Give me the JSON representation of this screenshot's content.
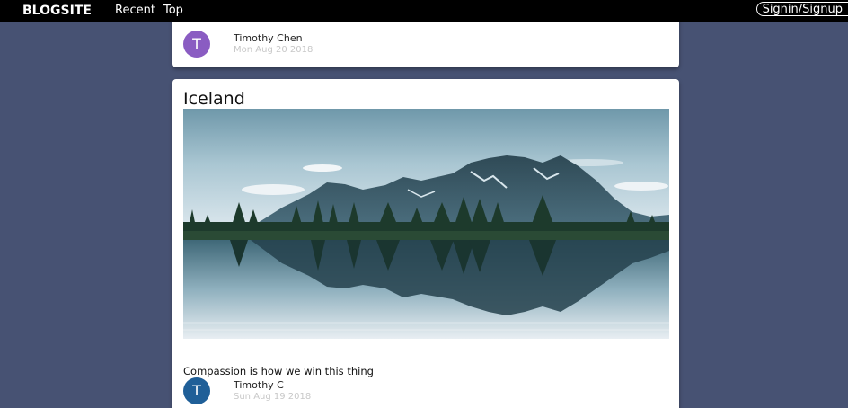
{
  "navbar": {
    "brand": "BLOGSITE",
    "links": [
      "Recent",
      "Top"
    ],
    "signin_label": "Signin/Signup",
    "background": "#000000"
  },
  "page": {
    "background": "#475273"
  },
  "posts": [
    {
      "author": "Timothy Chen",
      "avatar_letter": "T",
      "avatar_color": "#8a5cc2",
      "date": "Mon Aug 20 2018"
    },
    {
      "title": "Iceland",
      "image": "mountain-lake-reflection-image",
      "text": "Compassion is how we win this thing",
      "author": "Timothy C",
      "avatar_letter": "T",
      "avatar_color": "#1f5f98",
      "date": "Sun Aug 19 2018"
    }
  ]
}
